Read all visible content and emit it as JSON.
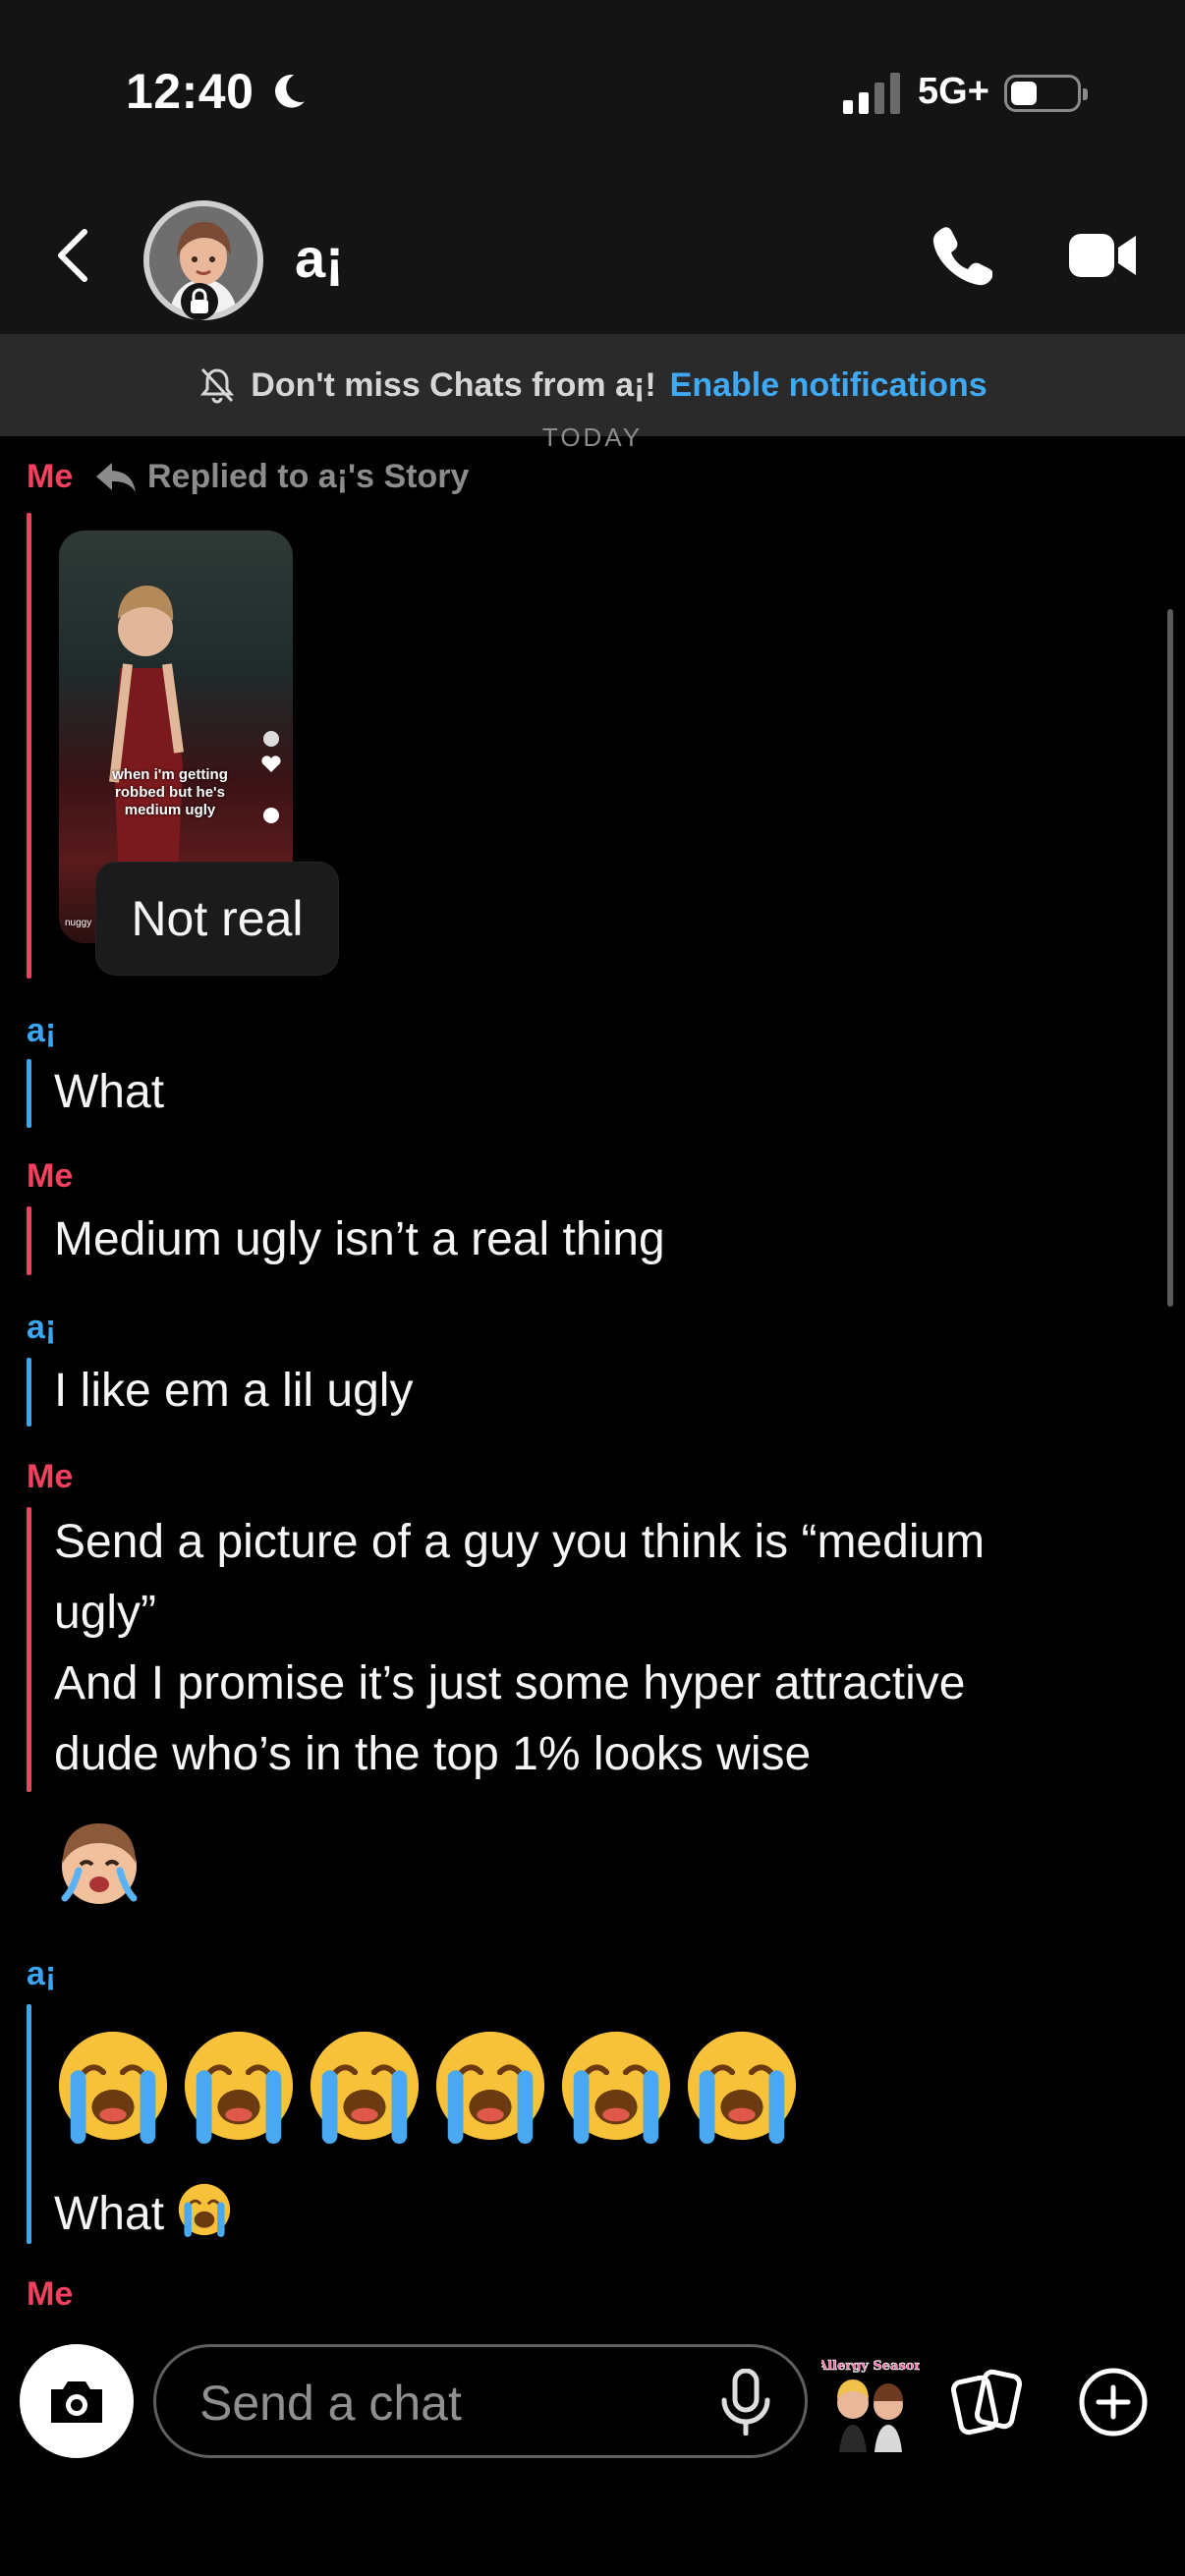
{
  "status": {
    "time": "12:40",
    "network": "5G+"
  },
  "header": {
    "name": "a¡"
  },
  "banner": {
    "text": "Don't miss Chats from a¡!",
    "link": "Enable notifications"
  },
  "divider": {
    "label": "TODAY"
  },
  "messages": [
    {
      "sender": "Me",
      "replied": "Replied to a¡'s Story",
      "story_caption": "when i'm getting robbed but he's medium ugly",
      "story_tag": "nuggy",
      "text": "Not real"
    },
    {
      "sender": "a¡",
      "text": "What"
    },
    {
      "sender": "Me",
      "text": "Medium ugly isn’t a real thing"
    },
    {
      "sender": "a¡",
      "text": "I like em a lil ugly"
    },
    {
      "sender": "Me",
      "lines": [
        "Send a picture of a guy you think is “medium",
        "ugly”",
        "And I promise it’s just some hyper attractive",
        "dude who’s in the top 1% looks wise"
      ]
    },
    {
      "sender": "a¡",
      "emoji_count": 6,
      "text": "What"
    },
    {
      "sender": "Me"
    }
  ],
  "input": {
    "placeholder": "Send a chat"
  },
  "sticker": {
    "label": "Allergy Season"
  },
  "colors": {
    "me": "#f2405e",
    "friend": "#3ba6f2",
    "link": "#3fa9f5"
  },
  "icons": [
    "back-icon",
    "lock-icon",
    "phone-icon",
    "video-icon",
    "bell-off-icon",
    "reply-icon",
    "camera-icon",
    "mic-icon",
    "cards-icon",
    "plus-icon",
    "crying-emoji-icon"
  ]
}
